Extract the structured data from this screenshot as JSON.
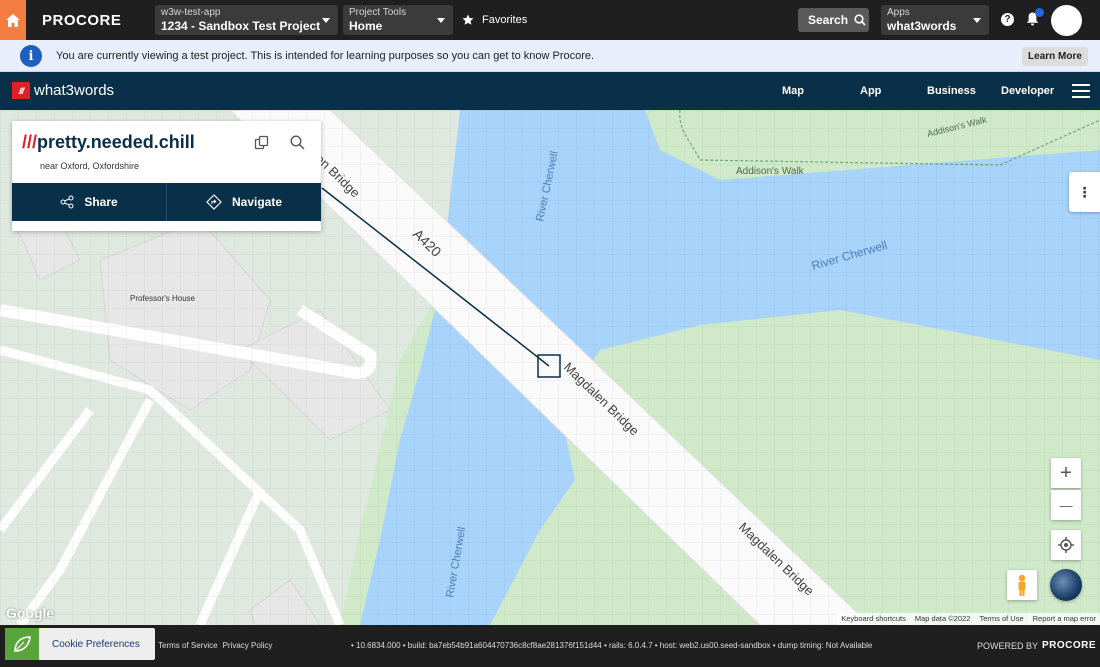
{
  "procore": {
    "logo": "PROCORE",
    "company": {
      "label": "w3w-test-app",
      "value": "1234 - Sandbox Test Project"
    },
    "tools": {
      "label": "Project Tools",
      "value": "Home"
    },
    "favorites": "Favorites",
    "search": "Search",
    "apps": {
      "label": "Apps",
      "value": "what3words"
    },
    "help": "?"
  },
  "banner": {
    "message": "You are currently viewing a test project. This is intended for learning purposes so you can get to know Procore.",
    "learn_more": "Learn More",
    "info": "i"
  },
  "w3w": {
    "logo_mark": "///",
    "logo_text": "what3words",
    "nav": [
      "Map",
      "App",
      "Business",
      "Developer"
    ]
  },
  "card": {
    "slashes": "///",
    "address": "pretty.needed.chill",
    "near": "near Oxford, Oxfordshire",
    "share": "Share",
    "navigate": "Navigate"
  },
  "map": {
    "labels": {
      "bridge_top": "Magdalen Bridge",
      "a420": "A420",
      "bridge_mid": "Magdalen Bridge",
      "bridge_low": "Magdalen Bridge",
      "river_top": "River Cherwell",
      "river_right": "River Cherwell",
      "river_bottom": "River Cherwell",
      "addisons_walk": "Addison's Walk",
      "addisons_walk_top": "Addison's Walk",
      "professors_house": "Professor's House"
    },
    "google": "Google",
    "attribution": [
      "Keyboard shortcuts",
      "Map data ©2022",
      "Terms of Use",
      "Report a map error"
    ],
    "zoom_in": "+",
    "zoom_out": "—",
    "side_menu": "⋮"
  },
  "footer": {
    "cookie": "Cookie Preferences",
    "terms": "Terms of Service",
    "privacy": "Privacy Policy",
    "build": "• 10.6834.000 • build: ba7eb54b91a604470736c8cf8ae281376f151d44 • rails: 6.0.4.7 • host: web2.us00.seed-sandbox • dump timing: Not Available",
    "powered_by": "POWERED BY",
    "powered_logo": "PROCORE"
  },
  "colors": {
    "brand_orange": "#f47e42",
    "w3w_navy": "#0a3049",
    "w3w_red": "#e11f26",
    "water": "#a8d3fb",
    "park": "#cfe9c9"
  }
}
